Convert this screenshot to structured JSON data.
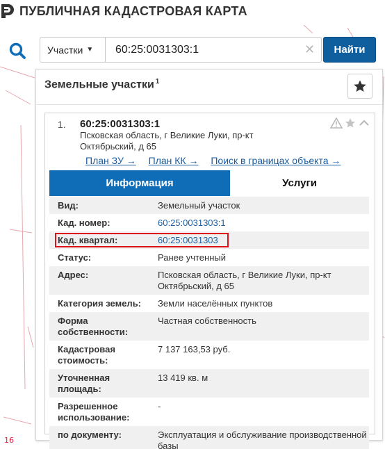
{
  "app": {
    "title": "ПУБЛИЧНАЯ КАДАСТРОВАЯ КАРТА"
  },
  "search": {
    "type_select": "Участки",
    "query": "60:25:0031303:1",
    "find_label": "Найти"
  },
  "panel": {
    "title": "Земельные участки",
    "count_sup": "1"
  },
  "result": {
    "number": "1.",
    "cad_number": "60:25:0031303:1",
    "address": "Псковская область, г Великие Луки, пр-кт Октябрьский, д 65",
    "links": [
      "План ЗУ →",
      "План КК →",
      "Поиск в границах объекта →"
    ],
    "tabs": [
      "Информация",
      "Услуги"
    ],
    "attributes": [
      {
        "key": "Вид:",
        "value": "Земельный участок",
        "link": false
      },
      {
        "key": "Кад. номер:",
        "value": "60:25:0031303:1",
        "link": true
      },
      {
        "key": "Кад. квартал:",
        "value": "60:25:0031303",
        "link": true,
        "highlight": true
      },
      {
        "key": "Статус:",
        "value": "Ранее учтенный",
        "link": false
      },
      {
        "key": "Адрес:",
        "value": "Псковская область, г Великие Луки, пр-кт Октябрьский, д 65",
        "link": false
      },
      {
        "key": "Категория земель:",
        "value": "Земли населённых пунктов",
        "link": false
      },
      {
        "key": "Форма собственности:",
        "value": "Частная собственность",
        "link": false
      },
      {
        "key": "Кадастровая стоимость:",
        "value": "7 137 163,53 руб.",
        "link": false
      },
      {
        "key": "Уточненная площадь:",
        "value": "13 419 кв. м",
        "link": false
      },
      {
        "key": "Разрешенное использование:",
        "value": "-",
        "link": false
      },
      {
        "key": "по документу:",
        "value": "Эксплуатация и обслуживание производственной базы",
        "link": false
      }
    ]
  },
  "map": {
    "corner_label": "16"
  },
  "colors": {
    "accent": "#0f6db8",
    "button": "#0f5f9f",
    "link": "#1a5fa3",
    "highlight": "#e0101a"
  },
  "icons": [
    "search-icon",
    "chevron-down-icon",
    "close-icon",
    "star-icon",
    "warning-icon",
    "chevron-up-icon",
    "logo-icon"
  ]
}
